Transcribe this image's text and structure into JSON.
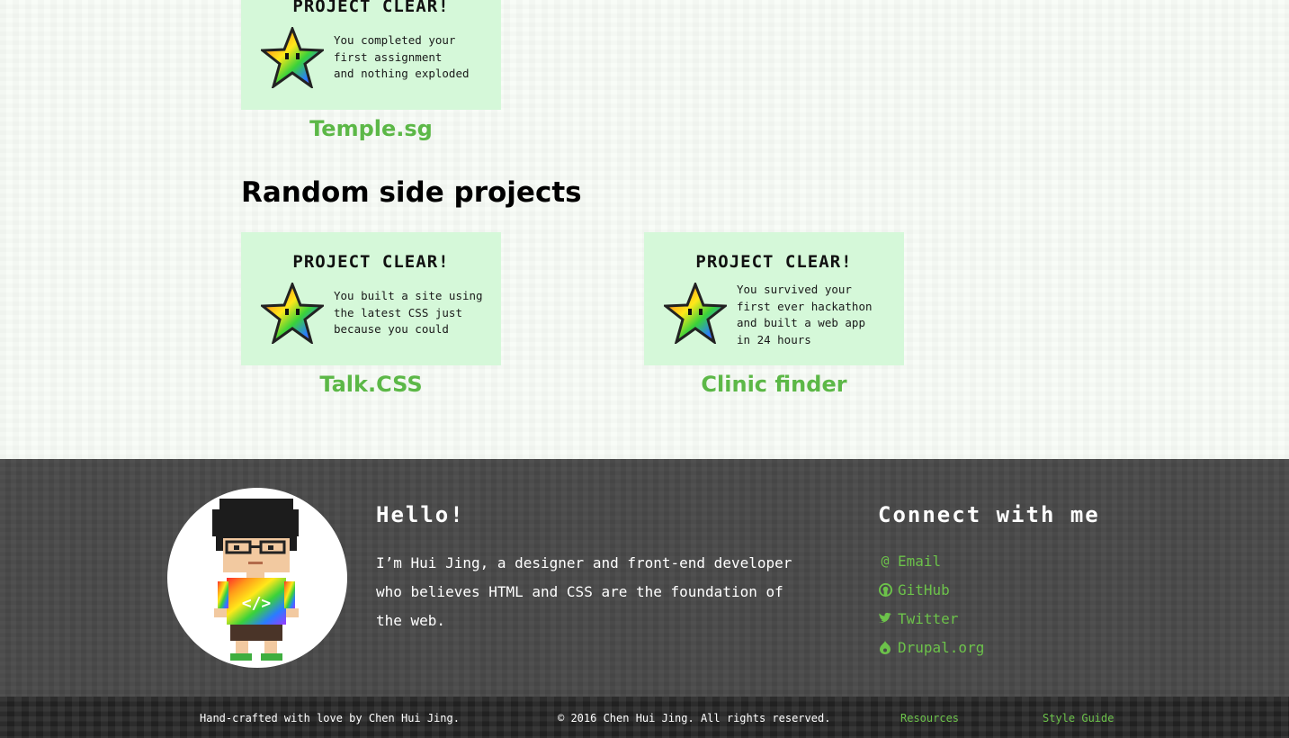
{
  "featured": {
    "card": {
      "headline": "PROJECT CLEAR!",
      "description": "You completed your\nfirst assignment\nand nothing exploded"
    },
    "title": "Temple.sg"
  },
  "side_projects": {
    "heading": "Random side projects",
    "items": [
      {
        "card": {
          "headline": "PROJECT CLEAR!",
          "description": "You built a site using\nthe latest CSS just\nbecause you could"
        },
        "title": "Talk.CSS"
      },
      {
        "card": {
          "headline": "PROJECT CLEAR!",
          "description": "You survived your\nfirst ever hackathon\nand built a web app\nin 24 hours"
        },
        "title": "Clinic finder"
      }
    ]
  },
  "footer": {
    "hello_heading": "Hello!",
    "bio": "I’m Hui Jing, a designer and front-end developer who believes HTML and CSS are the foundation of the web.",
    "connect_heading": "Connect with me",
    "links": [
      {
        "icon": "at-icon",
        "label": "Email"
      },
      {
        "icon": "github-icon",
        "label": "GitHub"
      },
      {
        "icon": "twitter-icon",
        "label": "Twitter"
      },
      {
        "icon": "drupal-icon",
        "label": "Drupal.org"
      }
    ]
  },
  "bottom_bar": {
    "credit": "Hand-crafted with love by Chen Hui Jing.",
    "copyright": "© 2016 Chen Hui Jing. All rights reserved.",
    "resources": "Resources",
    "style_guide": "Style Guide"
  },
  "colors": {
    "accent_green": "#5cb847",
    "card_bg": "#d5f8d9",
    "footer_bg": "#4a4a4a",
    "bottom_bar_bg": "#2c2c2c"
  }
}
